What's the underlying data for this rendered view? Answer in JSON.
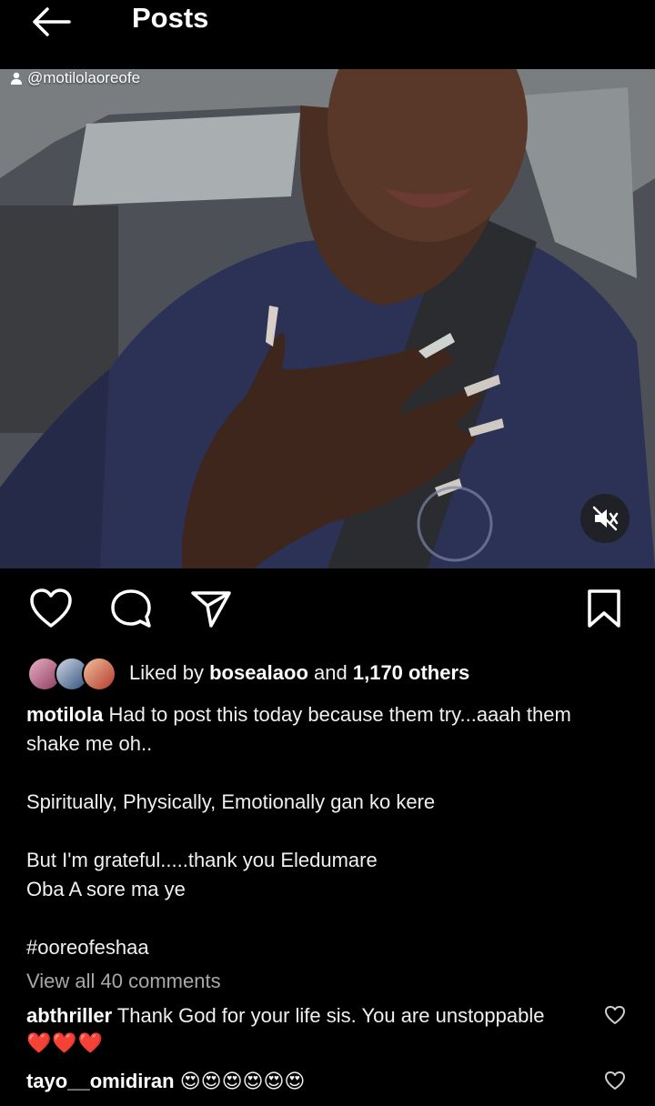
{
  "header": {
    "title": "Posts"
  },
  "post": {
    "tagged_user": "@motilolaoreofe",
    "likes": {
      "prefix": "Liked by",
      "user": "bosealaoo",
      "middle": "and",
      "count": "1,170 others"
    },
    "caption": {
      "username": "motilola",
      "line1": "Had to post this today because them try...aaah them",
      "line2": "shake me oh..",
      "line3": "Spiritually, Physically, Emotionally gan ko kere",
      "line4": "But I'm grateful.....thank you Eledumare",
      "line5": "Oba A sore ma ye",
      "hashtag": "#ooreofeshaa"
    },
    "view_all_comments": "View all 40 comments",
    "comments": [
      {
        "username": "abthriller",
        "text": "Thank God for your life sis. You are unstoppable",
        "emoji": "❤️❤️❤️"
      },
      {
        "username": "tayo__omidiran",
        "text": "😍😍😍😍😍😍"
      }
    ]
  },
  "colors": {
    "background": "#000000",
    "text": "#f0f0f0",
    "muted": "#a8a8a8"
  },
  "icons": [
    "back-arrow-icon",
    "person-icon",
    "muted-speaker-icon",
    "heart-icon",
    "comment-icon",
    "share-icon",
    "bookmark-icon"
  ]
}
